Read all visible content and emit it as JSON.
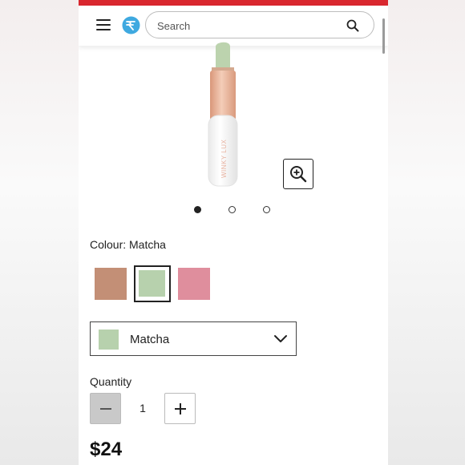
{
  "header": {
    "search": {
      "placeholder": "Search"
    }
  },
  "product": {
    "brand_on_tube": "WINKY LUX",
    "carousel": {
      "total_images": 3,
      "active_index": 0
    }
  },
  "colour": {
    "label": "Colour: Matcha",
    "swatches": [
      {
        "name": "swatch-tan",
        "color": "#c38f76",
        "selected": false
      },
      {
        "name": "swatch-matcha",
        "color": "#b7d1ad",
        "selected": true
      },
      {
        "name": "swatch-pink",
        "color": "#df8e9d",
        "selected": false
      }
    ],
    "dropdown": {
      "selected": "Matcha",
      "swatch_color": "#b7d1ad"
    }
  },
  "quantity": {
    "label": "Quantity",
    "value": "1"
  },
  "price": "$24",
  "colors": {
    "brand_red": "#d9272e",
    "logo_blue": "#3fa9e0",
    "tube_white": "#f4f4f4",
    "collar_rose_gold": "#e9b59a",
    "bullet_green": "#bcd3ae"
  },
  "icons": [
    "menu-icon",
    "logo-icon",
    "search-icon",
    "zoom-in-icon",
    "chevron-down-icon",
    "minus-icon",
    "plus-icon"
  ]
}
